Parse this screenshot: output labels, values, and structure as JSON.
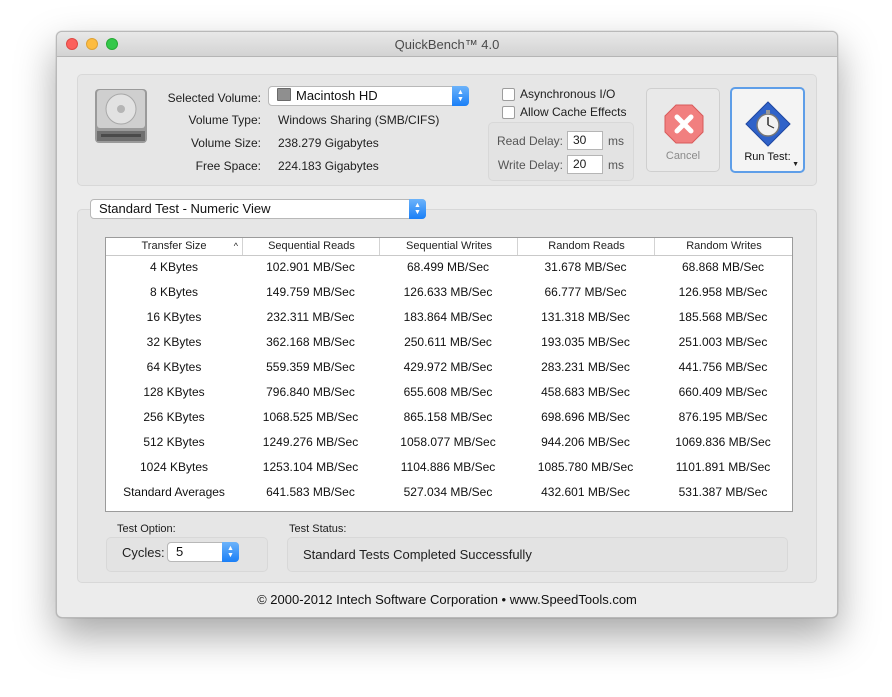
{
  "window": {
    "title": "QuickBench™ 4.0"
  },
  "volume": {
    "selected_label": "Selected Volume:",
    "selected_value": "Macintosh HD",
    "type_label": "Volume Type:",
    "type_value": "Windows Sharing (SMB/CIFS)",
    "size_label": "Volume Size:",
    "size_value": "238.279 Gigabytes",
    "free_label": "Free Space:",
    "free_value": "224.183 Gigabytes"
  },
  "options": {
    "async_label": "Asynchronous I/O",
    "async_checked": false,
    "cache_label": "Allow Cache Effects",
    "cache_checked": false,
    "read_delay_label": "Read Delay:",
    "read_delay_value": "30",
    "write_delay_label": "Write Delay:",
    "write_delay_value": "20",
    "unit": "ms"
  },
  "buttons": {
    "cancel_label": "Cancel",
    "run_label": "Run Test:"
  },
  "view_selector": {
    "value": "Standard Test - Numeric View"
  },
  "table": {
    "columns": [
      "Transfer Size",
      "Sequential Reads",
      "Sequential Writes",
      "Random Reads",
      "Random Writes"
    ],
    "rows": [
      [
        "4 KBytes",
        "102.901 MB/Sec",
        "68.499 MB/Sec",
        "31.678 MB/Sec",
        "68.868 MB/Sec"
      ],
      [
        "8 KBytes",
        "149.759 MB/Sec",
        "126.633 MB/Sec",
        "66.777 MB/Sec",
        "126.958 MB/Sec"
      ],
      [
        "16 KBytes",
        "232.311 MB/Sec",
        "183.864 MB/Sec",
        "131.318 MB/Sec",
        "185.568 MB/Sec"
      ],
      [
        "32 KBytes",
        "362.168 MB/Sec",
        "250.611 MB/Sec",
        "193.035 MB/Sec",
        "251.003 MB/Sec"
      ],
      [
        "64 KBytes",
        "559.359 MB/Sec",
        "429.972 MB/Sec",
        "283.231 MB/Sec",
        "441.756 MB/Sec"
      ],
      [
        "128 KBytes",
        "796.840 MB/Sec",
        "655.608 MB/Sec",
        "458.683 MB/Sec",
        "660.409 MB/Sec"
      ],
      [
        "256 KBytes",
        "1068.525 MB/Sec",
        "865.158 MB/Sec",
        "698.696 MB/Sec",
        "876.195 MB/Sec"
      ],
      [
        "512 KBytes",
        "1249.276 MB/Sec",
        "1058.077 MB/Sec",
        "944.206 MB/Sec",
        "1069.836 MB/Sec"
      ],
      [
        "1024 KBytes",
        "1253.104 MB/Sec",
        "1104.886 MB/Sec",
        "1085.780 MB/Sec",
        "1101.891 MB/Sec"
      ],
      [
        "Standard Averages",
        "641.583 MB/Sec",
        "527.034 MB/Sec",
        "432.601 MB/Sec",
        "531.387 MB/Sec"
      ]
    ]
  },
  "test_option": {
    "label": "Test Option:",
    "cycles_label": "Cycles:",
    "cycles_value": "5"
  },
  "test_status": {
    "label": "Test Status:",
    "value": "Standard Tests Completed Successfully"
  },
  "footer": {
    "text": "© 2000-2012 Intech Software Corporation • www.SpeedTools.com"
  }
}
